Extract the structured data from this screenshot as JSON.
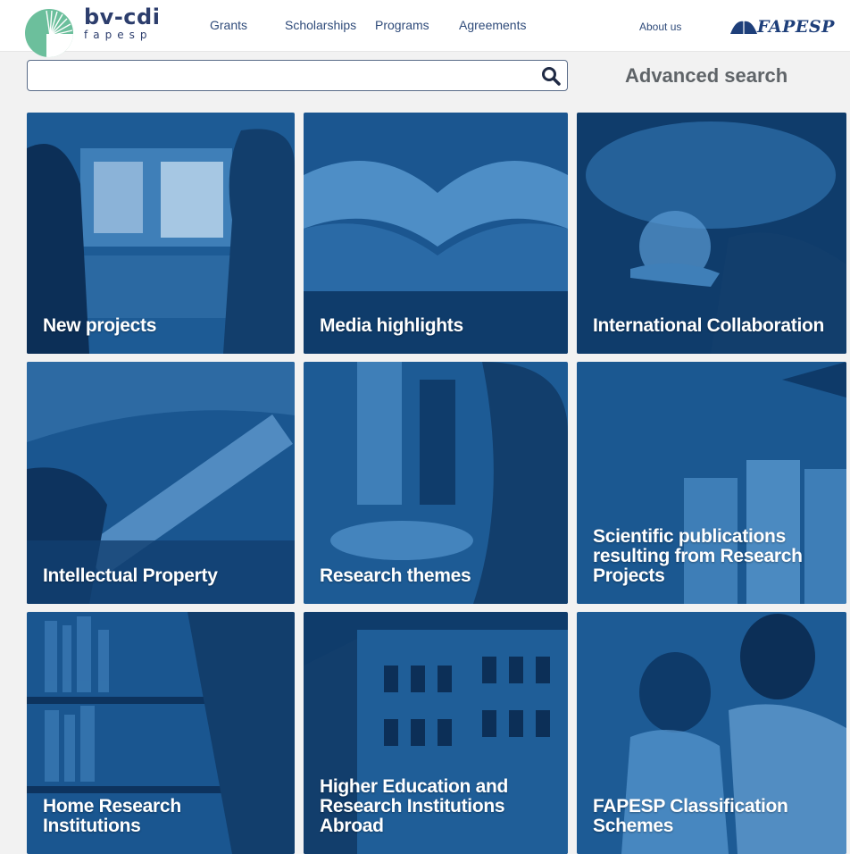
{
  "logo": {
    "name": "bv-cdi",
    "sub": "fapesp"
  },
  "nav": {
    "items": [
      "Grants",
      "Scholarships",
      "Programs",
      "Agreements"
    ],
    "about": "About us",
    "brand": "FAPESP"
  },
  "search": {
    "value": "",
    "placeholder": "",
    "advanced_label": "Advanced search"
  },
  "tiles": [
    {
      "label": "New projects"
    },
    {
      "label": "Media highlights"
    },
    {
      "label": "International Collaboration"
    },
    {
      "label": "Intellectual Property"
    },
    {
      "label": "Research themes"
    },
    {
      "label": "Scientific publications resulting from Research Projects"
    },
    {
      "label": "Home Research Institutions"
    },
    {
      "label": "Higher Education and Research Institutions Abroad"
    },
    {
      "label": "FAPESP Classification Schemes"
    }
  ],
  "colors": {
    "tile_blue": "#1c5a94",
    "tile_dark": "#0f3c6b",
    "logo_green": "#6cbf9c",
    "brand_navy": "#1e3f7a"
  }
}
